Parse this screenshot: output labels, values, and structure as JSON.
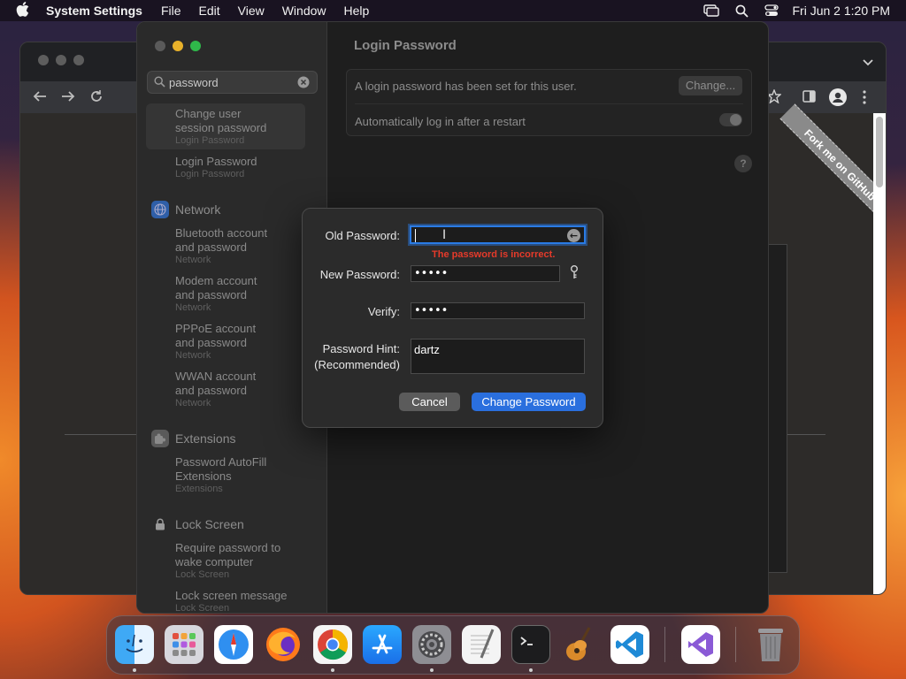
{
  "menubar": {
    "app_name": "System Settings",
    "items": [
      "File",
      "Edit",
      "View",
      "Window",
      "Help"
    ],
    "clock": "Fri Jun 2  1:20 PM"
  },
  "browser": {
    "ribbon": "Fork me on GitHub"
  },
  "settings": {
    "search": {
      "value": "password",
      "placeholder": "Search"
    },
    "results": [
      {
        "title": "Change user session password",
        "line1": "Change user",
        "line2": "session password",
        "sub": "Login Password"
      },
      {
        "title": "Login Password",
        "line1": "Login Password",
        "sub": "Login Password"
      },
      {
        "title": "Bluetooth account and password",
        "line1": "Bluetooth account",
        "line2": "and password",
        "sub": "Network"
      },
      {
        "title": "Modem account and password",
        "line1": "Modem account",
        "line2": "and password",
        "sub": "Network"
      },
      {
        "title": "PPPoE account and password",
        "line1": "PPPoE account",
        "line2": "and password",
        "sub": "Network"
      },
      {
        "title": "WWAN account and password",
        "line1": "WWAN account",
        "line2": "and password",
        "sub": "Network"
      },
      {
        "title": "Password AutoFill Extensions",
        "line1": "Password AutoFill",
        "line2": "Extensions",
        "sub": "Extensions"
      },
      {
        "title": "Require password to wake computer",
        "line1": "Require password to",
        "line2": "wake computer",
        "sub": "Lock Screen"
      },
      {
        "title": "Lock screen message",
        "line1": "Lock screen message",
        "sub": "Lock Screen"
      }
    ],
    "categories": {
      "network": "Network",
      "extensions": "Extensions",
      "lock_screen": "Lock Screen"
    },
    "main": {
      "title": "Login Password",
      "password_set_text": "A login password has been set for this user.",
      "change_button": "Change...",
      "auto_login_text": "Automatically log in after a restart",
      "auto_login_enabled": false,
      "help": "?"
    }
  },
  "dialog": {
    "old_password_label": "Old Password:",
    "old_password_value": "",
    "error": "The password is incorrect.",
    "new_password_label": "New Password:",
    "new_password_value": "•••••",
    "verify_label": "Verify:",
    "verify_value": "•••••",
    "hint_label": "Password Hint:",
    "hint_sublabel": "(Recommended)",
    "hint_value": "dartz",
    "cancel_button": "Cancel",
    "change_button": "Change Password"
  },
  "dock": {
    "apps": [
      "Finder",
      "Launchpad",
      "Safari",
      "Firefox",
      "Google Chrome",
      "App Store",
      "System Settings",
      "TextEdit",
      "Terminal",
      "GarageBand",
      "Visual Studio Code",
      "Visual Studio",
      "Trash"
    ]
  }
}
